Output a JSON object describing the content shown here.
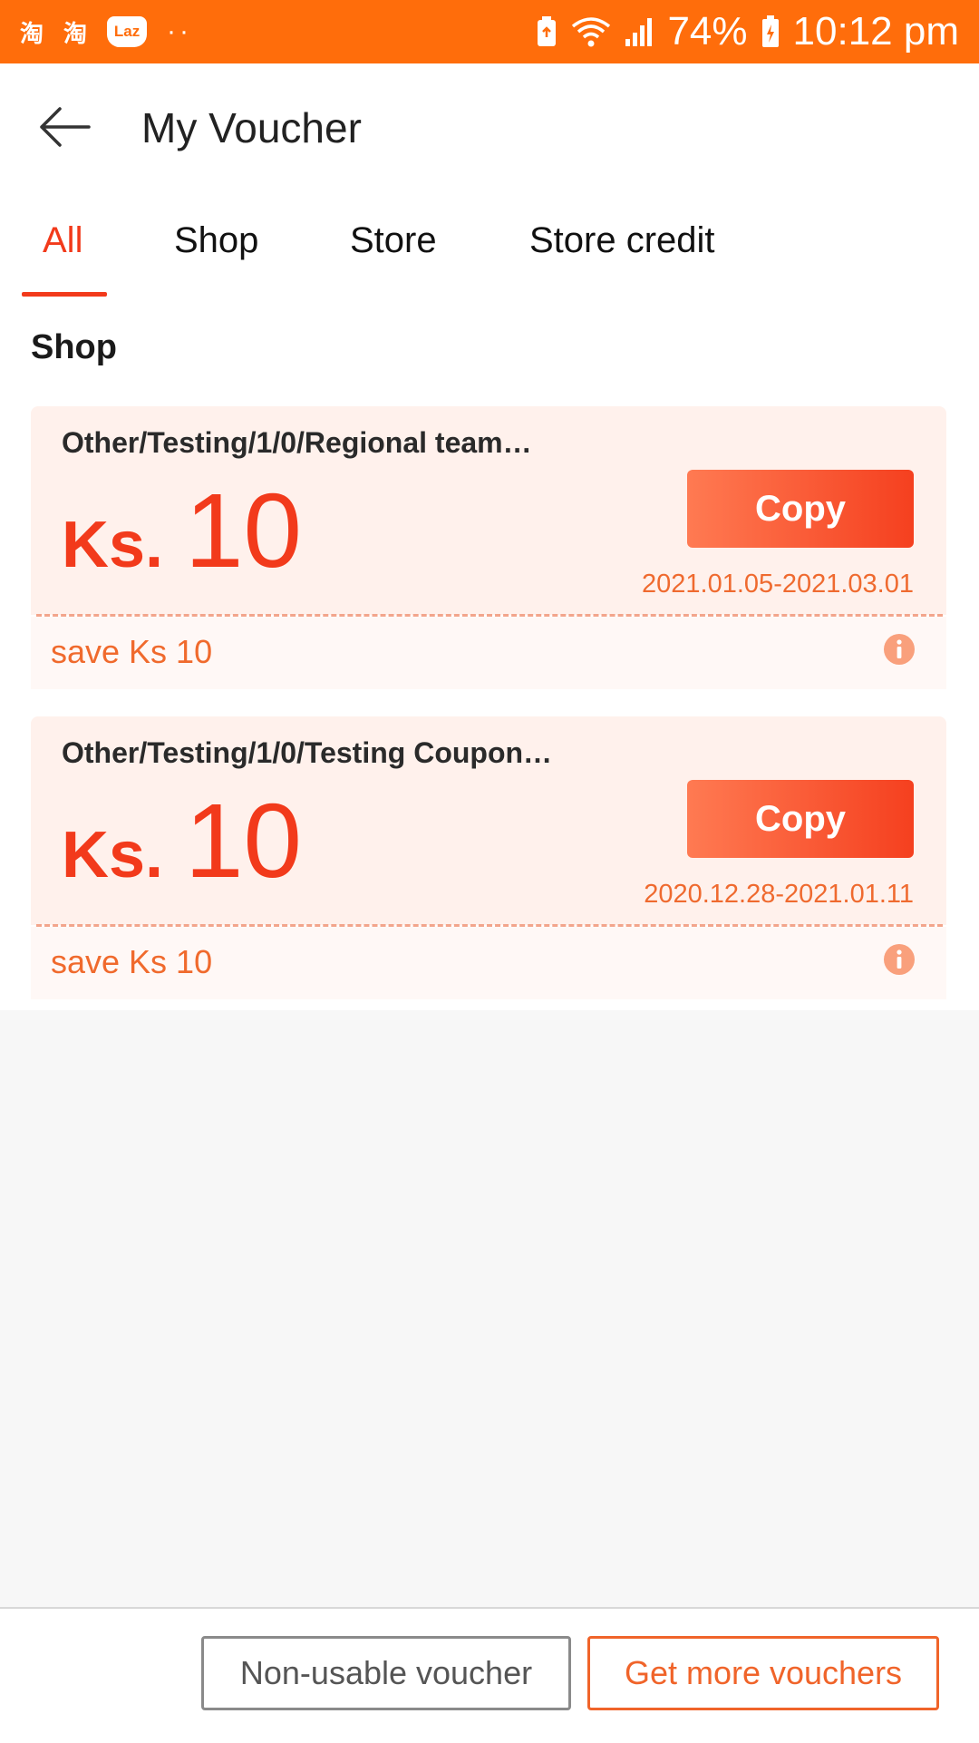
{
  "status_bar": {
    "app_icons": [
      "淘",
      "淘"
    ],
    "laz_label": "Laz",
    "dots": "··",
    "battery_percent": "74%",
    "time": "10:12 pm",
    "color": "#ff6d0b"
  },
  "header": {
    "title": "My Voucher"
  },
  "tabs": [
    {
      "label": "All",
      "active": true
    },
    {
      "label": "Shop",
      "active": false
    },
    {
      "label": "Store",
      "active": false
    },
    {
      "label": "Store credit",
      "active": false
    }
  ],
  "section": {
    "title": "Shop"
  },
  "vouchers": [
    {
      "name": "Other/Testing/1/0/Regional team…",
      "currency": "Ks.",
      "amount": "10",
      "copy_label": "Copy",
      "validity": "2021.01.05-2021.03.01",
      "save_text": "save Ks 10"
    },
    {
      "name": "Other/Testing/1/0/Testing Coupon…",
      "currency": "Ks.",
      "amount": "10",
      "copy_label": "Copy",
      "validity": "2020.12.28-2021.01.11",
      "save_text": "save Ks 10"
    }
  ],
  "footer": {
    "non_usable_label": "Non-usable voucher",
    "get_more_label": "Get more vouchers"
  },
  "colors": {
    "accent": "#f23a1b",
    "orange": "#f0642a"
  }
}
